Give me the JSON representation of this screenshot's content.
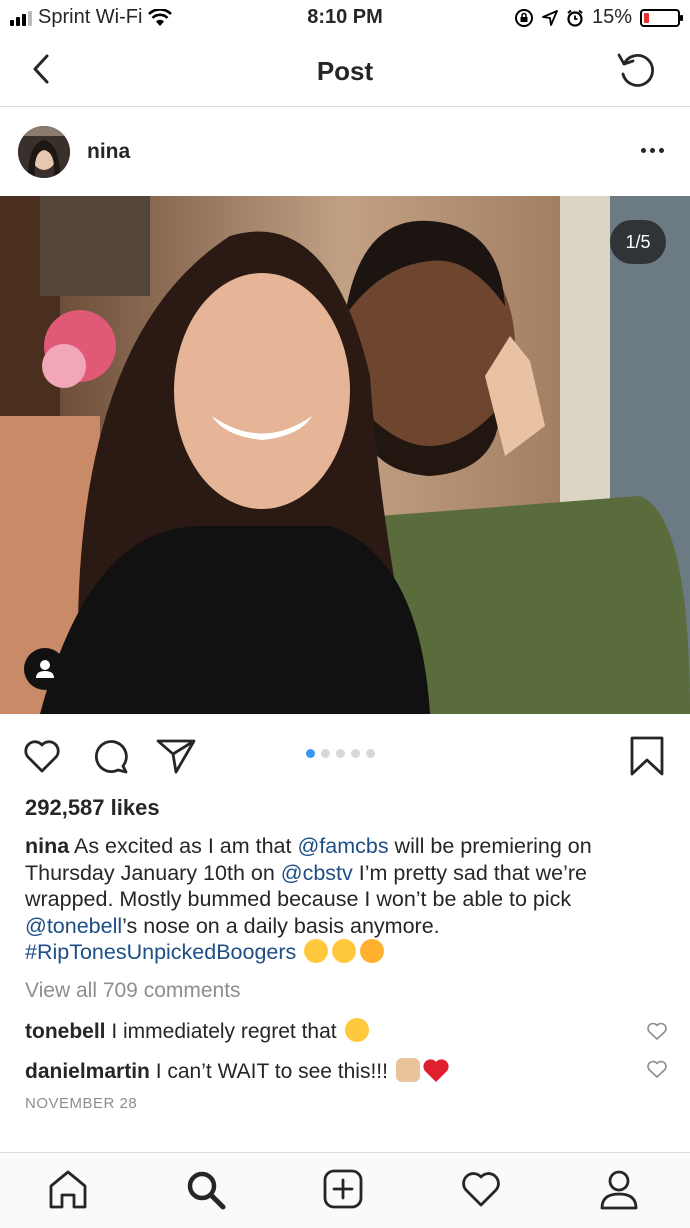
{
  "status_bar": {
    "carrier": "Sprint Wi-Fi",
    "time": "8:10 PM",
    "battery": "15%",
    "battery_fraction": 0.15
  },
  "nav": {
    "title": "Post",
    "back_icon": "chevron-left-icon",
    "refresh_icon": "refresh-icon"
  },
  "post": {
    "username": "nina",
    "photo_counter": "1/5",
    "carousel_total": 5,
    "carousel_index": 1,
    "likes": "292,587 likes",
    "caption": {
      "user": "nina",
      "t1": " As excited as I am that ",
      "m1": "@famcbs",
      "t2": " will be premiering on Thursday January 10th on ",
      "m2": "@cbstv",
      "t3": " I’m pretty sad that we’re wrapped. Mostly bummed because I won’t be able to pick ",
      "m3": "@tonebell",
      "t4": "’s nose on a daily basis anymore. ",
      "hashtag": "#RipTonesUnpickedBoogers"
    },
    "view_all": "View all 709 comments",
    "comments": [
      {
        "user": "tonebell",
        "text": " I immediately regret that"
      },
      {
        "user": "danielmartin",
        "text": " I can’t WAIT to see this!!!"
      }
    ],
    "date": "NOVEMBER 28"
  },
  "colors": {
    "link": "#1d4e86",
    "accent": "#3897f0",
    "battery_low": "#e6302d"
  }
}
